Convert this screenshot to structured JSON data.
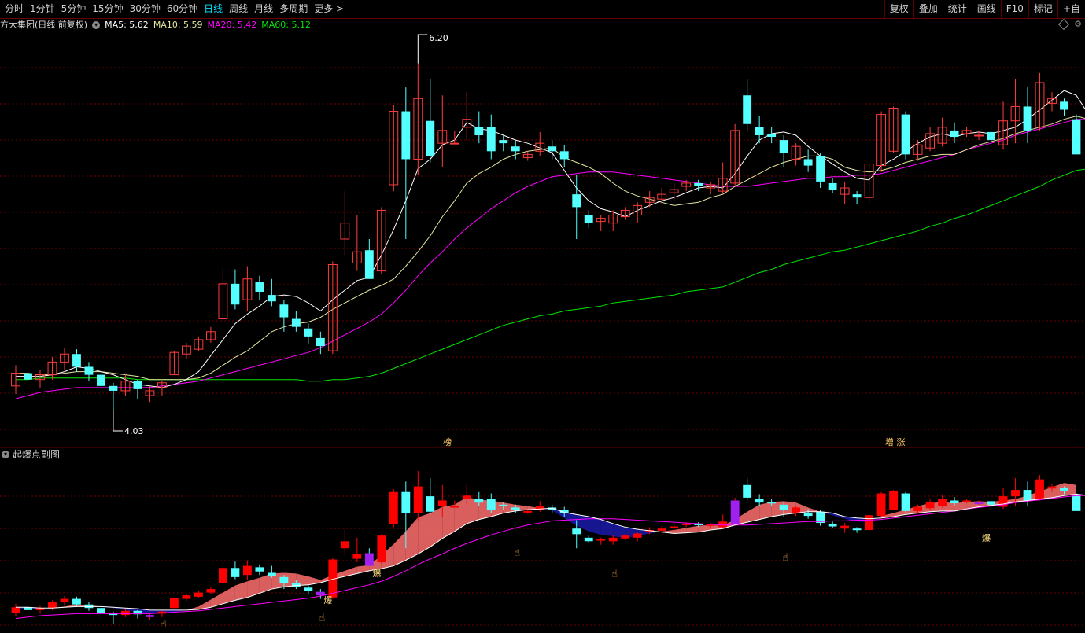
{
  "toolbar": {
    "tabs": [
      "分时",
      "1分钟",
      "5分钟",
      "15分钟",
      "30分钟",
      "60分钟",
      "日线",
      "周线",
      "月线",
      "多周期",
      "更多 >"
    ],
    "active_tab": "日线",
    "right_buttons": [
      "复权",
      "叠加",
      "统计",
      "画线",
      "F10",
      "标记",
      "+自"
    ]
  },
  "info": {
    "stock": "方大集团(日线 前复权)",
    "ma5": "MA5: 5.62",
    "ma10": "MA10: 5.59",
    "ma20": "MA20: 5.42",
    "ma60": "MA60: 5.12"
  },
  "colors": {
    "up": "#ff3c3c",
    "down": "#54ffff",
    "ma5": "#ffffff",
    "ma10": "#e6e6a0",
    "ma20": "#ff00ff",
    "ma60": "#00e600",
    "grid": "#6a0000",
    "sub_up": "#ff0000",
    "purple": "#a020f0",
    "fill_up": "#ff7070",
    "fill_down": "#1a1aaa"
  },
  "chart_data": {
    "type": "candlestick",
    "high_label": "6.20",
    "low_label": "4.03",
    "markers": [
      "榜",
      "增 涨"
    ],
    "sub_title": "起爆点副图",
    "sub_marker_text": "爆",
    "icon": "pointing-hand-icon",
    "ohlc": [
      [
        4.18,
        4.31,
        4.13,
        4.26
      ],
      [
        4.26,
        4.31,
        4.18,
        4.22
      ],
      [
        4.22,
        4.28,
        4.17,
        4.25
      ],
      [
        4.25,
        4.36,
        4.22,
        4.33
      ],
      [
        4.33,
        4.42,
        4.28,
        4.38
      ],
      [
        4.38,
        4.41,
        4.27,
        4.3
      ],
      [
        4.3,
        4.33,
        4.21,
        4.25
      ],
      [
        4.25,
        4.27,
        4.1,
        4.18
      ],
      [
        4.18,
        4.2,
        4.03,
        4.15
      ],
      [
        4.15,
        4.25,
        4.12,
        4.21
      ],
      [
        4.21,
        4.22,
        4.1,
        4.16
      ],
      [
        4.12,
        4.18,
        4.08,
        4.15
      ],
      [
        4.17,
        4.21,
        4.12,
        4.2
      ],
      [
        4.25,
        4.4,
        4.25,
        4.39
      ],
      [
        4.38,
        4.45,
        4.35,
        4.43
      ],
      [
        4.41,
        4.49,
        4.4,
        4.47
      ],
      [
        4.47,
        4.55,
        4.45,
        4.52
      ],
      [
        4.6,
        4.92,
        4.58,
        4.82
      ],
      [
        4.82,
        4.91,
        4.66,
        4.69
      ],
      [
        4.72,
        4.93,
        4.65,
        4.85
      ],
      [
        4.83,
        4.87,
        4.72,
        4.77
      ],
      [
        4.75,
        4.85,
        4.68,
        4.71
      ],
      [
        4.69,
        4.72,
        4.52,
        4.61
      ],
      [
        4.6,
        4.65,
        4.52,
        4.55
      ],
      [
        4.54,
        4.57,
        4.44,
        4.49
      ],
      [
        4.48,
        4.52,
        4.38,
        4.43
      ],
      [
        4.4,
        4.96,
        4.38,
        4.94
      ],
      [
        5.1,
        5.4,
        5.0,
        5.2
      ],
      [
        4.95,
        5.25,
        4.9,
        5.02
      ],
      [
        5.03,
        5.1,
        4.85,
        4.85
      ],
      [
        4.9,
        5.3,
        4.88,
        5.28
      ],
      [
        5.44,
        5.94,
        5.4,
        5.9
      ],
      [
        5.9,
        6.05,
        5.1,
        5.6
      ],
      [
        5.6,
        6.2,
        5.5,
        5.98
      ],
      [
        5.84,
        6.1,
        5.58,
        5.62
      ],
      [
        5.7,
        6.0,
        5.55,
        5.78
      ],
      [
        5.7,
        5.78,
        5.7,
        5.7
      ],
      [
        5.8,
        6.02,
        5.72,
        5.85
      ],
      [
        5.8,
        5.9,
        5.7,
        5.75
      ],
      [
        5.8,
        5.88,
        5.6,
        5.65
      ],
      [
        5.72,
        5.75,
        5.65,
        5.7
      ],
      [
        5.68,
        5.72,
        5.6,
        5.65
      ],
      [
        5.61,
        5.65,
        5.59,
        5.63
      ],
      [
        5.65,
        5.77,
        5.62,
        5.7
      ],
      [
        5.68,
        5.72,
        5.6,
        5.65
      ],
      [
        5.65,
        5.69,
        5.55,
        5.6
      ],
      [
        5.38,
        5.5,
        5.1,
        5.3
      ],
      [
        5.25,
        5.28,
        5.17,
        5.2
      ],
      [
        5.21,
        5.25,
        5.15,
        5.23
      ],
      [
        5.2,
        5.28,
        5.15,
        5.25
      ],
      [
        5.24,
        5.3,
        5.22,
        5.28
      ],
      [
        5.25,
        5.33,
        5.2,
        5.31
      ],
      [
        5.33,
        5.4,
        5.3,
        5.36
      ],
      [
        5.35,
        5.42,
        5.32,
        5.38
      ],
      [
        5.39,
        5.45,
        5.34,
        5.41
      ],
      [
        5.43,
        5.47,
        5.4,
        5.45
      ],
      [
        5.45,
        5.47,
        5.4,
        5.43
      ],
      [
        5.42,
        5.46,
        5.38,
        5.44
      ],
      [
        5.4,
        5.58,
        5.38,
        5.48
      ],
      [
        5.45,
        5.82,
        5.43,
        5.78
      ],
      [
        6.0,
        6.1,
        5.78,
        5.82
      ],
      [
        5.8,
        5.87,
        5.7,
        5.75
      ],
      [
        5.76,
        5.8,
        5.7,
        5.74
      ],
      [
        5.72,
        5.75,
        5.55,
        5.64
      ],
      [
        5.6,
        5.7,
        5.56,
        5.68
      ],
      [
        5.6,
        5.66,
        5.52,
        5.56
      ],
      [
        5.62,
        5.64,
        5.42,
        5.46
      ],
      [
        5.45,
        5.48,
        5.39,
        5.41
      ],
      [
        5.38,
        5.46,
        5.32,
        5.42
      ],
      [
        5.38,
        5.4,
        5.32,
        5.36
      ],
      [
        5.36,
        5.58,
        5.33,
        5.57
      ],
      [
        5.56,
        5.9,
        5.52,
        5.88
      ],
      [
        5.65,
        5.93,
        5.64,
        5.92
      ],
      [
        5.88,
        5.9,
        5.6,
        5.63
      ],
      [
        5.63,
        5.72,
        5.59,
        5.69
      ],
      [
        5.67,
        5.8,
        5.65,
        5.76
      ],
      [
        5.7,
        5.86,
        5.68,
        5.8
      ],
      [
        5.78,
        5.83,
        5.7,
        5.74
      ],
      [
        5.76,
        5.8,
        5.74,
        5.78
      ],
      [
        5.75,
        5.78,
        5.72,
        5.75
      ],
      [
        5.77,
        5.82,
        5.7,
        5.72
      ],
      [
        5.69,
        5.96,
        5.66,
        5.84
      ],
      [
        5.84,
        6.1,
        5.7,
        5.93
      ],
      [
        5.93,
        6.05,
        5.7,
        5.78
      ],
      [
        5.8,
        6.14,
        5.78,
        6.08
      ],
      [
        5.95,
        6.02,
        5.9,
        5.98
      ],
      [
        5.96,
        5.98,
        5.87,
        5.91
      ],
      [
        5.85,
        5.88,
        5.72,
        5.63
      ]
    ],
    "ma5": [
      4.24,
      4.24,
      4.24,
      4.25,
      4.27,
      4.3,
      4.29,
      4.27,
      4.25,
      4.22,
      4.19,
      4.18,
      4.17,
      4.19,
      4.22,
      4.27,
      4.37,
      4.47,
      4.57,
      4.63,
      4.68,
      4.74,
      4.75,
      4.74,
      4.7,
      4.65,
      4.72,
      4.78,
      4.84,
      4.86,
      5.0,
      5.16,
      5.34,
      5.54,
      5.6,
      5.69,
      5.72,
      5.83,
      5.79,
      5.78,
      5.75,
      5.72,
      5.7,
      5.67,
      5.64,
      5.53,
      5.42,
      5.34,
      5.29,
      5.27,
      5.24,
      5.28,
      5.31,
      5.34,
      5.36,
      5.39,
      5.42,
      5.43,
      5.42,
      5.51,
      5.62,
      5.72,
      5.76,
      5.77,
      5.75,
      5.68,
      5.62,
      5.57,
      5.52,
      5.48,
      5.47,
      5.56,
      5.6,
      5.65,
      5.7,
      5.74,
      5.76,
      5.74,
      5.76,
      5.77,
      5.76,
      5.78,
      5.8,
      5.85,
      5.91,
      5.97,
      6.03,
      6.0,
      5.88
    ],
    "ma10": [
      4.26,
      4.26,
      4.25,
      4.25,
      4.26,
      4.27,
      4.27,
      4.27,
      4.26,
      4.25,
      4.24,
      4.22,
      4.22,
      4.22,
      4.22,
      4.23,
      4.26,
      4.31,
      4.36,
      4.4,
      4.46,
      4.52,
      4.55,
      4.57,
      4.58,
      4.61,
      4.66,
      4.7,
      4.74,
      4.78,
      4.81,
      4.85,
      4.93,
      5.02,
      5.12,
      5.24,
      5.34,
      5.45,
      5.51,
      5.55,
      5.6,
      5.63,
      5.65,
      5.66,
      5.67,
      5.61,
      5.58,
      5.55,
      5.51,
      5.45,
      5.4,
      5.37,
      5.35,
      5.33,
      5.31,
      5.32,
      5.33,
      5.36,
      5.38,
      5.43,
      5.47,
      5.51,
      5.55,
      5.58,
      5.6,
      5.62,
      5.62,
      5.6,
      5.55,
      5.53,
      5.52,
      5.53,
      5.55,
      5.58,
      5.6,
      5.62,
      5.63,
      5.63,
      5.66,
      5.69,
      5.71,
      5.73,
      5.76,
      5.78,
      5.8,
      5.82,
      5.85,
      5.87,
      5.85
    ],
    "ma20": [
      4.1,
      4.12,
      4.14,
      4.15,
      4.16,
      4.17,
      4.17,
      4.17,
      4.17,
      4.17,
      4.17,
      4.17,
      4.18,
      4.19,
      4.2,
      4.21,
      4.23,
      4.25,
      4.27,
      4.29,
      4.31,
      4.33,
      4.35,
      4.37,
      4.39,
      4.42,
      4.46,
      4.5,
      4.54,
      4.58,
      4.63,
      4.7,
      4.78,
      4.87,
      4.95,
      5.02,
      5.1,
      5.17,
      5.23,
      5.29,
      5.34,
      5.39,
      5.43,
      5.46,
      5.49,
      5.5,
      5.51,
      5.52,
      5.52,
      5.52,
      5.51,
      5.5,
      5.49,
      5.48,
      5.47,
      5.46,
      5.45,
      5.44,
      5.43,
      5.43,
      5.43,
      5.44,
      5.45,
      5.46,
      5.47,
      5.48,
      5.48,
      5.49,
      5.49,
      5.5,
      5.5,
      5.51,
      5.53,
      5.55,
      5.57,
      5.59,
      5.61,
      5.63,
      5.66,
      5.68,
      5.7,
      5.72,
      5.75,
      5.77,
      5.79,
      5.81,
      5.83,
      5.85,
      5.85
    ],
    "ma60": [
      4.22,
      4.22,
      4.23,
      4.23,
      4.23,
      4.23,
      4.23,
      4.23,
      4.23,
      4.23,
      4.22,
      4.22,
      4.22,
      4.22,
      4.22,
      4.22,
      4.22,
      4.22,
      4.22,
      4.22,
      4.22,
      4.22,
      4.22,
      4.22,
      4.21,
      4.21,
      4.22,
      4.22,
      4.23,
      4.24,
      4.26,
      4.29,
      4.32,
      4.35,
      4.38,
      4.41,
      4.44,
      4.47,
      4.5,
      4.53,
      4.56,
      4.58,
      4.6,
      4.62,
      4.63,
      4.65,
      4.66,
      4.67,
      4.68,
      4.7,
      4.71,
      4.72,
      4.73,
      4.74,
      4.75,
      4.77,
      4.78,
      4.79,
      4.8,
      4.83,
      4.86,
      4.89,
      4.91,
      4.94,
      4.96,
      4.98,
      5.0,
      5.02,
      5.03,
      5.05,
      5.07,
      5.09,
      5.11,
      5.13,
      5.15,
      5.18,
      5.2,
      5.23,
      5.25,
      5.28,
      5.31,
      5.34,
      5.37,
      5.4,
      5.43,
      5.47,
      5.5,
      5.53,
      5.54
    ]
  }
}
